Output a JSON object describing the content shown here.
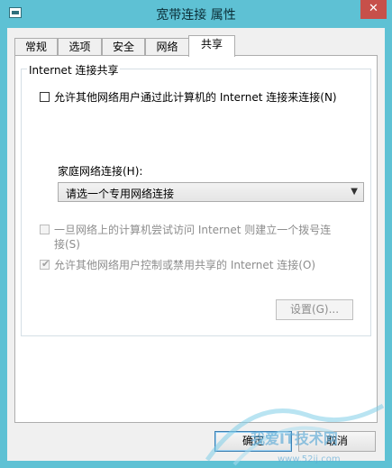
{
  "window": {
    "title": "宽带连接 属性",
    "close_glyph": "✕"
  },
  "tabs": [
    {
      "label": "常规"
    },
    {
      "label": "选项"
    },
    {
      "label": "安全"
    },
    {
      "label": "网络"
    },
    {
      "label": "共享"
    }
  ],
  "active_tab": "共享",
  "sharing": {
    "group_title": "Internet 连接共享",
    "allow_share": {
      "label": "允许其他网络用户通过此计算机的 Internet 连接来连接(N)",
      "checked": false
    },
    "home_network_label": "家庭网络连接(H):",
    "home_network_select": {
      "value": "请选一个专用网络连接"
    },
    "dial_on_demand": {
      "label_line1": "一旦网络上的计算机尝试访问 Internet 则建立一个拨号连",
      "label_line2": "接(S)",
      "checked": false,
      "enabled": false
    },
    "allow_control": {
      "label": "允许其他网络用户控制或禁用共享的 Internet 连接(O)",
      "checked": true,
      "enabled": false
    },
    "settings_button": "设置(G)..."
  },
  "buttons": {
    "ok": "确定",
    "cancel": "取消"
  },
  "watermark": {
    "text": "我爱IT技术网",
    "url": "www.52ij.com"
  }
}
